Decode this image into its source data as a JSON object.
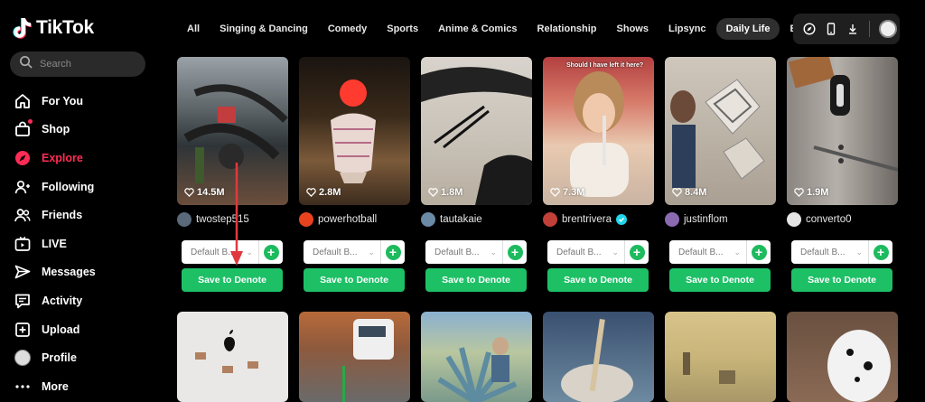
{
  "brand": {
    "name": "TikTok"
  },
  "search": {
    "placeholder": "Search"
  },
  "nav": [
    {
      "label": "For You",
      "icon": "home-icon"
    },
    {
      "label": "Shop",
      "icon": "shop-icon"
    },
    {
      "label": "Explore",
      "icon": "compass-icon",
      "active": true
    },
    {
      "label": "Following",
      "icon": "following-icon"
    },
    {
      "label": "Friends",
      "icon": "friends-icon"
    },
    {
      "label": "LIVE",
      "icon": "live-icon"
    },
    {
      "label": "Messages",
      "icon": "messages-icon"
    },
    {
      "label": "Activity",
      "icon": "activity-icon"
    },
    {
      "label": "Upload",
      "icon": "upload-icon"
    },
    {
      "label": "Profile",
      "icon": "profile-avatar"
    },
    {
      "label": "More",
      "icon": "more-icon"
    }
  ],
  "tabs": [
    "All",
    "Singing & Dancing",
    "Comedy",
    "Sports",
    "Anime & Comics",
    "Relationship",
    "Shows",
    "Lipsync",
    "Daily Life",
    "Beauty C"
  ],
  "active_tab": "Daily Life",
  "videos": [
    {
      "likes": "14.5M",
      "author": "twostep515",
      "select": "Default B...",
      "save": "Save to Denote"
    },
    {
      "likes": "2.8M",
      "author": "powerhotball",
      "select": "Default B...",
      "save": "Save to Denote"
    },
    {
      "likes": "1.8M",
      "author": "tautakaie",
      "select": "Default B...",
      "save": "Save to Denote"
    },
    {
      "likes": "7.3M",
      "author": "brentrivera",
      "verified": true,
      "select": "Default B...",
      "save": "Save to Denote",
      "caption": "Should I have left it here?"
    },
    {
      "likes": "8.4M",
      "author": "justinflom",
      "select": "Default B...",
      "save": "Save to Denote"
    },
    {
      "likes": "1.9M",
      "author": "converto0",
      "select": "Default B...",
      "save": "Save to Denote"
    }
  ],
  "colors": {
    "accent": "#fe2c55",
    "save_green": "#1ec066",
    "verified": "#20d5ec",
    "annotation_arrow": "#e0393e"
  }
}
